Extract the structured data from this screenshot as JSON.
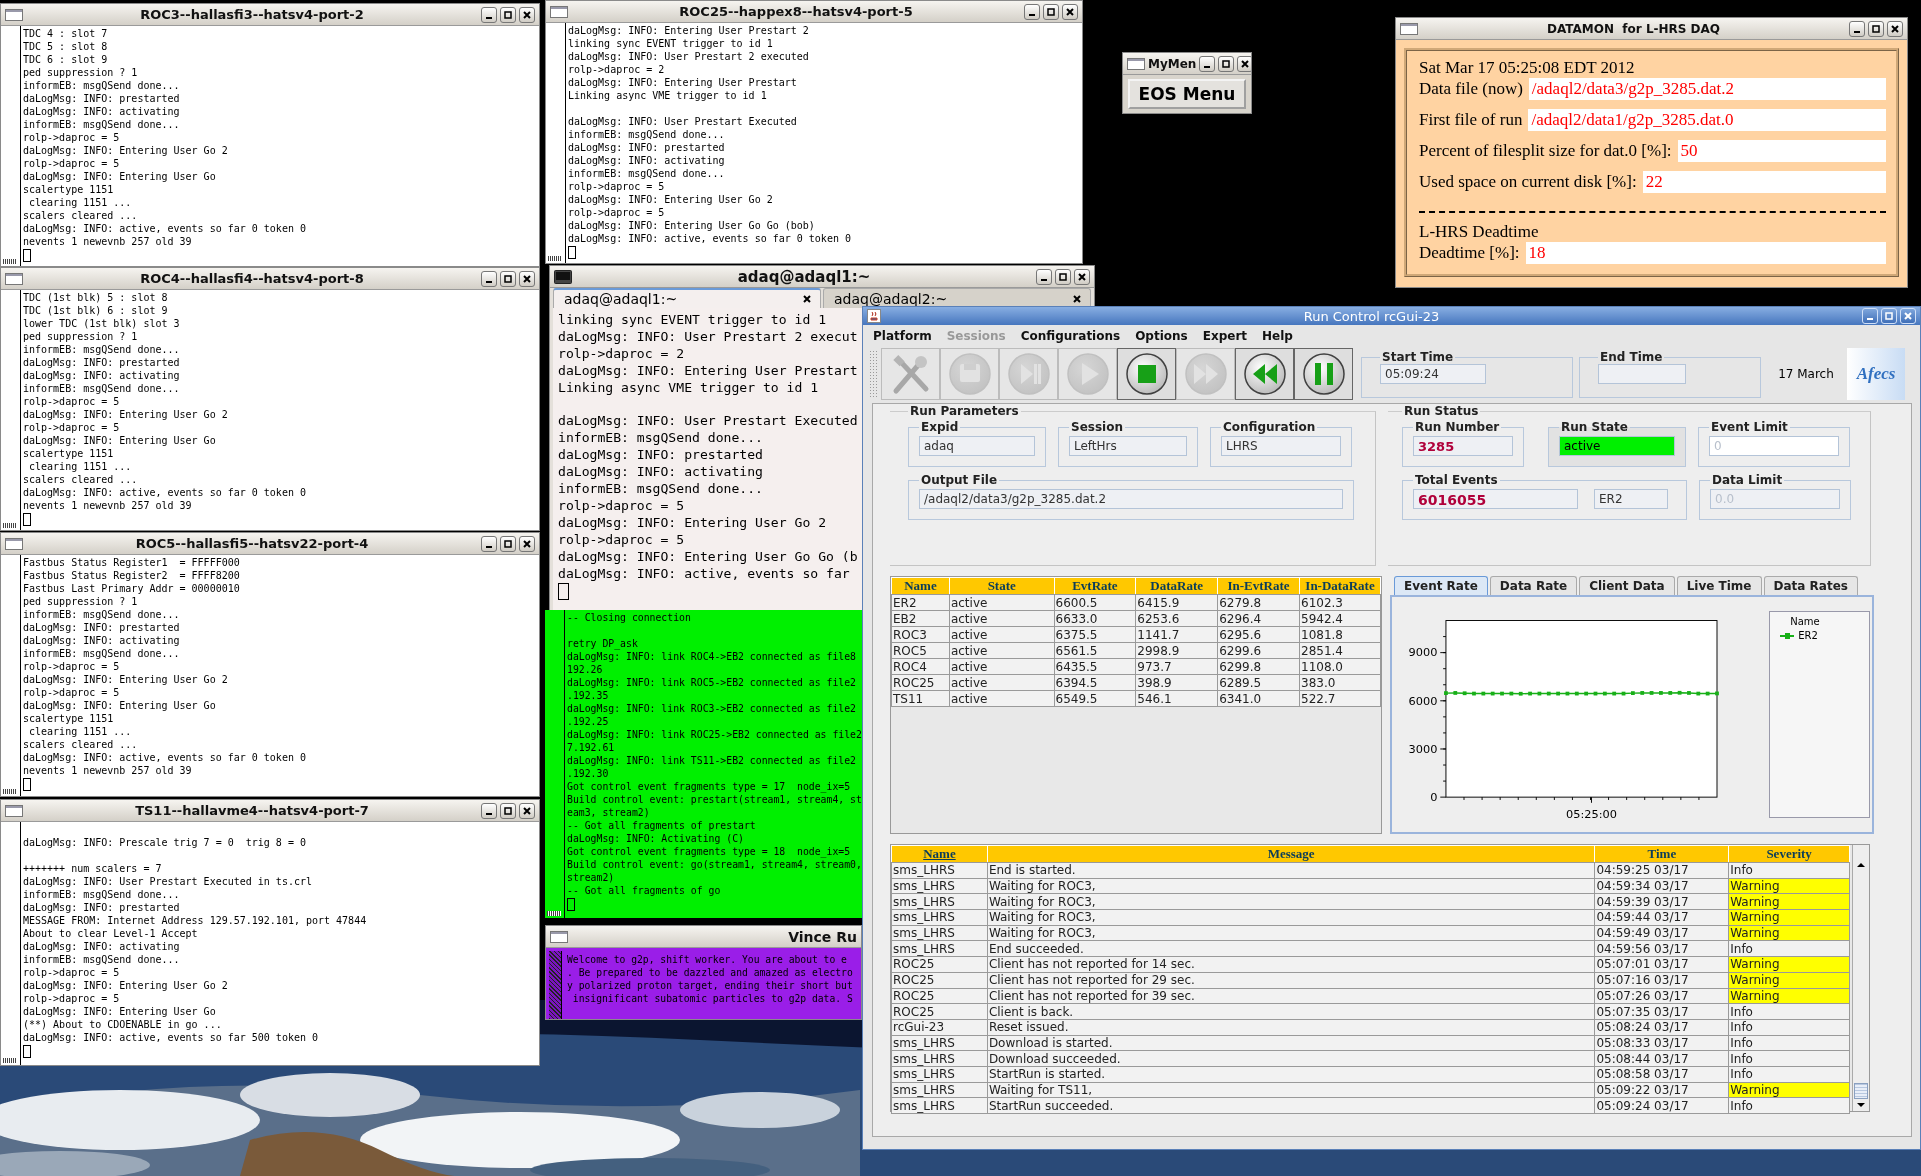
{
  "terminals": [
    {
      "title": "ROC3--hallasfi3--hatsv4-port-2",
      "leading_blank": false,
      "blocks": [
        [
          "TDC 4 : slot 7",
          "TDC 5 : slot 8",
          "TDC 6 : slot 9",
          "ped suppression ? 1",
          "informEB: msgQSend done...",
          "daLogMsg: INFO: prestarted",
          "daLogMsg: INFO: activating",
          "informEB: msgQSend done...",
          "rolp->daproc = 5",
          "daLogMsg: INFO: Entering User Go 2",
          "rolp->daproc = 5",
          "daLogMsg: INFO: Entering User Go",
          "scalertype 1151",
          " clearing 1151 ...",
          "scalers cleared ...",
          "daLogMsg: INFO: active, events so far 0 token 0",
          "nevents 1 newevnb 257 old 39"
        ]
      ]
    },
    {
      "title": "ROC4--hallasfi4--hatsv4-port-8",
      "leading_blank": false,
      "blocks": [
        [
          "TDC (1st blk) 5 : slot 8",
          "TDC (1st blk) 6 : slot 9",
          "lower TDC (1st blk) slot 3",
          "ped suppression ? 1",
          "informEB: msgQSend done...",
          "daLogMsg: INFO: prestarted",
          "daLogMsg: INFO: activating",
          "informEB: msgQSend done...",
          "rolp->daproc = 5",
          "daLogMsg: INFO: Entering User Go 2",
          "rolp->daproc = 5",
          "daLogMsg: INFO: Entering User Go",
          "scalertype 1151",
          " clearing 1151 ...",
          "scalers cleared ...",
          "daLogMsg: INFO: active, events so far 0 token 0",
          "nevents 1 newevnb 257 old 39"
        ]
      ]
    },
    {
      "title": "ROC5--hallasfi5--hatsv22-port-4",
      "leading_blank": false,
      "blocks": [
        [
          "Fastbus Status Register1  = FFFFF000",
          "Fastbus Status Register2  = FFFF8200",
          "Fastbus Last Primary Addr = 00000010",
          "ped suppression ? 1",
          "informEB: msgQSend done...",
          "daLogMsg: INFO: prestarted",
          "daLogMsg: INFO: activating",
          "informEB: msgQSend done...",
          "rolp->daproc = 5",
          "daLogMsg: INFO: Entering User Go 2",
          "rolp->daproc = 5",
          "daLogMsg: INFO: Entering User Go",
          "scalertype 1151",
          " clearing 1151 ...",
          "scalers cleared ...",
          "daLogMsg: INFO: active, events so far 0 token 0",
          "nevents 1 newevnb 257 old 39"
        ]
      ]
    },
    {
      "title": "TS11--hallavme4--hatsv4-port-7",
      "leading_blank": true,
      "blocks": [
        [
          "daLogMsg: INFO: Prescale trig 7 = 0  trig 8 = 0"
        ],
        [
          "+++++++ num scalers = 7",
          "daLogMsg: INFO: User Prestart Executed in ts.crl",
          "informEB: msgQSend done...",
          "daLogMsg: INFO: prestarted",
          "MESSAGE FROM: Internet Address 129.57.192.101, port 47844",
          "About to clear Level-1 Accept",
          "daLogMsg: INFO: activating",
          "informEB: msgQSend done...",
          "rolp->daproc = 5",
          "daLogMsg: INFO: Entering User Go 2",
          "rolp->daproc = 5",
          "daLogMsg: INFO: Entering User Go",
          "(**) About to CDOENABLE in go ...",
          "daLogMsg: INFO: active, events so far 500 token 0"
        ]
      ]
    },
    {
      "title": "ROC25--happex8--hatsv4-port-5",
      "leading_blank": false,
      "blocks": [
        [
          "daLogMsg: INFO: Entering User Prestart 2",
          "linking sync EVENT trigger to id 1",
          "daLogMsg: INFO: User Prestart 2 executed",
          "rolp->daproc = 2",
          "daLogMsg: INFO: Entering User Prestart",
          "Linking async VME trigger to id 1"
        ],
        [
          "daLogMsg: INFO: User Prestart Executed",
          "informEB: msgQSend done...",
          "daLogMsg: INFO: prestarted",
          "daLogMsg: INFO: activating",
          "informEB: msgQSend done...",
          "rolp->daproc = 5",
          "daLogMsg: INFO: Entering User Go 2",
          "rolp->daproc = 5",
          "daLogMsg: INFO: Entering User Go Go (bob)",
          "daLogMsg: INFO: active, events so far 0 token 0"
        ]
      ]
    }
  ],
  "adaq_terminal": {
    "title": "adaq@adaql1:~",
    "tabs": [
      {
        "label": "adaq@adaql1:~",
        "selected": true
      },
      {
        "label": "adaq@adaql2:~",
        "selected": false
      }
    ],
    "blocks": [
      [
        "linking sync EVENT trigger to id 1",
        "daLogMsg: INFO: User Prestart 2 execut",
        "rolp->daproc = 2",
        "daLogMsg: INFO: Entering User Prestart",
        "Linking async VME trigger to id 1"
      ],
      [
        "daLogMsg: INFO: User Prestart Executed",
        "informEB: msgQSend done...",
        "daLogMsg: INFO: prestarted",
        "daLogMsg: INFO: activating",
        "informEB: msgQSend done...",
        "rolp->daproc = 5",
        "daLogMsg: INFO: Entering User Go 2",
        "rolp->daproc = 5",
        "daLogMsg: INFO: Entering User Go Go (b",
        "daLogMsg: INFO: active, events so far"
      ]
    ]
  },
  "green_terminal": {
    "blocks": [
      [
        "-- Closing connection"
      ],
      [
        "retry DP_ask",
        "daLogMsg: INFO: link ROC4->EB2 connected as file8",
        "192.26",
        "daLogMsg: INFO: link ROC5->EB2 connected as file2",
        ".192.35",
        "daLogMsg: INFO: link ROC3->EB2 connected as file2",
        ".192.25",
        "daLogMsg: INFO: link ROC25->EB2 connected as file2",
        "7.192.61",
        "daLogMsg: INFO: link TS11->EB2 connected as file2",
        ".192.30",
        "Got control event fragments type = 17  node_ix=5",
        "Build control event: prestart(stream1, stream4, st",
        "eam3, stream2)",
        "-- Got all fragments of prestart",
        "daLogMsg: INFO: Activating (C)",
        "Got control event fragments type = 18  node_ix=5",
        "Build control event: go(stream1, stream4, stream0,",
        "stream2)",
        "-- Got all fragments of go"
      ]
    ]
  },
  "welcome_window": {
    "title": "Vince Ru",
    "lines": [
      "Welcome to g2p, shift worker. You are about to e",
      ". Be prepared to be dazzled and amazed as electro",
      "y polarized proton target, ending their short but",
      " insignificant subatomic particles to g2p data. S"
    ]
  },
  "mymen": {
    "title": "MyMen",
    "button": "EOS Menu"
  },
  "datamon": {
    "title": "DATAMON  for L-HRS DAQ",
    "timestamp": "Sat Mar 17 05:25:08 EDT 2012",
    "rows": [
      {
        "label": "Data file (now)",
        "value": "/adaql2/data3/g2p_3285.dat.2"
      },
      {
        "label": "First file of run",
        "value": "/adaql2/data1/g2p_3285.dat.0"
      },
      {
        "label": "Percent of filesplit size for dat.0 [%]:",
        "value": "50"
      },
      {
        "label": "Used space on current disk [%]:",
        "value": "22"
      }
    ],
    "section": "L-HRS Deadtime",
    "deadtime": {
      "label": "Deadtime [%]:",
      "value": "18"
    }
  },
  "run_control": {
    "title": "Run Control rcGui-23",
    "menu": [
      {
        "label": "Platform",
        "disabled": false
      },
      {
        "label": "Sessions",
        "disabled": true
      },
      {
        "label": "Configurations",
        "disabled": false
      },
      {
        "label": "Options",
        "disabled": false
      },
      {
        "label": "Expert",
        "disabled": false
      },
      {
        "label": "Help",
        "disabled": false
      }
    ],
    "toolbar": [
      {
        "kind": "tools",
        "disabled": true
      },
      {
        "kind": "save",
        "disabled": true
      },
      {
        "kind": "step",
        "disabled": true
      },
      {
        "kind": "play",
        "disabled": true
      },
      {
        "kind": "stop",
        "disabled": false
      },
      {
        "kind": "forward",
        "disabled": true
      },
      {
        "kind": "rewind",
        "disabled": false
      },
      {
        "kind": "pause",
        "disabled": false
      }
    ],
    "start_time": {
      "label": "Start Time",
      "value": "05:09:24"
    },
    "end_time": {
      "label": "End Time"
    },
    "date": "17 March",
    "logo": "Afecs",
    "run_parameters": {
      "title": "Run Parameters",
      "fields": [
        {
          "label": "Expid",
          "value": "adaq"
        },
        {
          "label": "Session",
          "value": "LeftHrs"
        },
        {
          "label": "Configuration",
          "value": "LHRS"
        }
      ],
      "output_file": {
        "label": "Output File",
        "value": "/adaql2/data3/g2p_3285.dat.2"
      }
    },
    "run_status": {
      "title": "Run Status",
      "run_number": {
        "label": "Run Number",
        "value": "3285"
      },
      "run_state": {
        "label": "Run State",
        "value": "active"
      },
      "event_limit": {
        "label": "Event Limit",
        "value": "0",
        "disabled": true
      },
      "total_events": {
        "label": "Total Events",
        "value": "6016055",
        "component": "ER2"
      },
      "data_limit": {
        "label": "Data Limit",
        "value": "0.0",
        "disabled": true
      }
    },
    "components_table": {
      "columns": [
        "Name",
        "State",
        "EvtRate",
        "DataRate",
        "In-EvtRate",
        "In-DataRate"
      ],
      "rows": [
        [
          "ER2",
          "active",
          "6600.5",
          "6415.9",
          "6279.8",
          "6102.3"
        ],
        [
          "EB2",
          "active",
          "6633.0",
          "6253.6",
          "6296.4",
          "5942.4"
        ],
        [
          "ROC3",
          "active",
          "6375.5",
          "1141.7",
          "6295.6",
          "1081.8"
        ],
        [
          "ROC5",
          "active",
          "6561.5",
          "2998.9",
          "6299.6",
          "2851.4"
        ],
        [
          "ROC4",
          "active",
          "6435.5",
          "973.7",
          "6299.8",
          "1108.0"
        ],
        [
          "ROC25",
          "active",
          "6394.5",
          "398.9",
          "6289.5",
          "383.0"
        ],
        [
          "TS11",
          "active",
          "6549.5",
          "546.1",
          "6341.0",
          "522.7"
        ]
      ]
    },
    "chart_tabs": [
      {
        "label": "Event Rate",
        "selected": true
      },
      {
        "label": "Data Rate",
        "selected": false
      },
      {
        "label": "Client Data",
        "selected": false
      },
      {
        "label": "Live Time",
        "selected": false
      },
      {
        "label": "Data Rates",
        "selected": false
      }
    ],
    "chart": {
      "legend_title": "Name",
      "chart_data": {
        "type": "line",
        "ylim": [
          0,
          11000
        ],
        "yticks": [
          0,
          3000,
          6000,
          9000
        ],
        "annotations": [
          {
            "text": "05:25:00"
          }
        ],
        "series": [
          {
            "name": "ER2",
            "color": "#18b018",
            "marker": "square",
            "values": [
              6480,
              6490,
              6470,
              6450,
              6450,
              6450,
              6450,
              6450,
              6440,
              6450,
              6450,
              6450,
              6450,
              6450,
              6450,
              6450,
              6450,
              6450,
              6450,
              6450,
              6480,
              6490,
              6490,
              6490,
              6490,
              6500,
              6490,
              6450,
              6450,
              6460
            ]
          }
        ]
      }
    },
    "messages": {
      "columns": [
        "Name",
        "Message",
        "Time",
        "Severity"
      ],
      "rows": [
        {
          "name": "sms_LHRS",
          "message": "End is started.",
          "time": "04:59:25 03/17",
          "severity": "Info",
          "highlighted": false
        },
        {
          "name": "sms_LHRS",
          "message": "Waiting for ROC3,",
          "time": "04:59:34 03/17",
          "severity": "Warning",
          "highlighted": true
        },
        {
          "name": "sms_LHRS",
          "message": "Waiting for ROC3,",
          "time": "04:59:39 03/17",
          "severity": "Warning",
          "highlighted": true
        },
        {
          "name": "sms_LHRS",
          "message": "Waiting for ROC3,",
          "time": "04:59:44 03/17",
          "severity": "Warning",
          "highlighted": true
        },
        {
          "name": "sms_LHRS",
          "message": "Waiting for ROC3,",
          "time": "04:59:49 03/17",
          "severity": "Warning",
          "highlighted": true
        },
        {
          "name": "sms_LHRS",
          "message": "End succeeded.",
          "time": "04:59:56 03/17",
          "severity": "Info",
          "highlighted": false
        },
        {
          "name": "ROC25",
          "message": "Client has not reported for 14 sec.",
          "time": "05:07:01 03/17",
          "severity": "Warning",
          "highlighted": true
        },
        {
          "name": "ROC25",
          "message": "Client has not reported for 29 sec.",
          "time": "05:07:16 03/17",
          "severity": "Warning",
          "highlighted": true
        },
        {
          "name": "ROC25",
          "message": "Client has not reported for 39 sec.",
          "time": "05:07:26 03/17",
          "severity": "Warning",
          "highlighted": true
        },
        {
          "name": "ROC25",
          "message": "Client is back.",
          "time": "05:07:35 03/17",
          "severity": "Info",
          "highlighted": false
        },
        {
          "name": "rcGui-23",
          "message": "Reset issued.",
          "time": "05:08:24 03/17",
          "severity": "Info",
          "highlighted": false
        },
        {
          "name": "sms_LHRS",
          "message": "Download is started.",
          "time": "05:08:33 03/17",
          "severity": "Info",
          "highlighted": false
        },
        {
          "name": "sms_LHRS",
          "message": "Download succeeded.",
          "time": "05:08:44 03/17",
          "severity": "Info",
          "highlighted": false
        },
        {
          "name": "sms_LHRS",
          "message": "StartRun is started.",
          "time": "05:08:58 03/17",
          "severity": "Info",
          "highlighted": false
        },
        {
          "name": "sms_LHRS",
          "message": "Waiting for TS11,",
          "time": "05:09:22 03/17",
          "severity": "Warning",
          "highlighted": true
        },
        {
          "name": "sms_LHRS",
          "message": "StartRun succeeded.",
          "time": "05:09:24 03/17",
          "severity": "Info",
          "highlighted": false
        }
      ]
    }
  }
}
